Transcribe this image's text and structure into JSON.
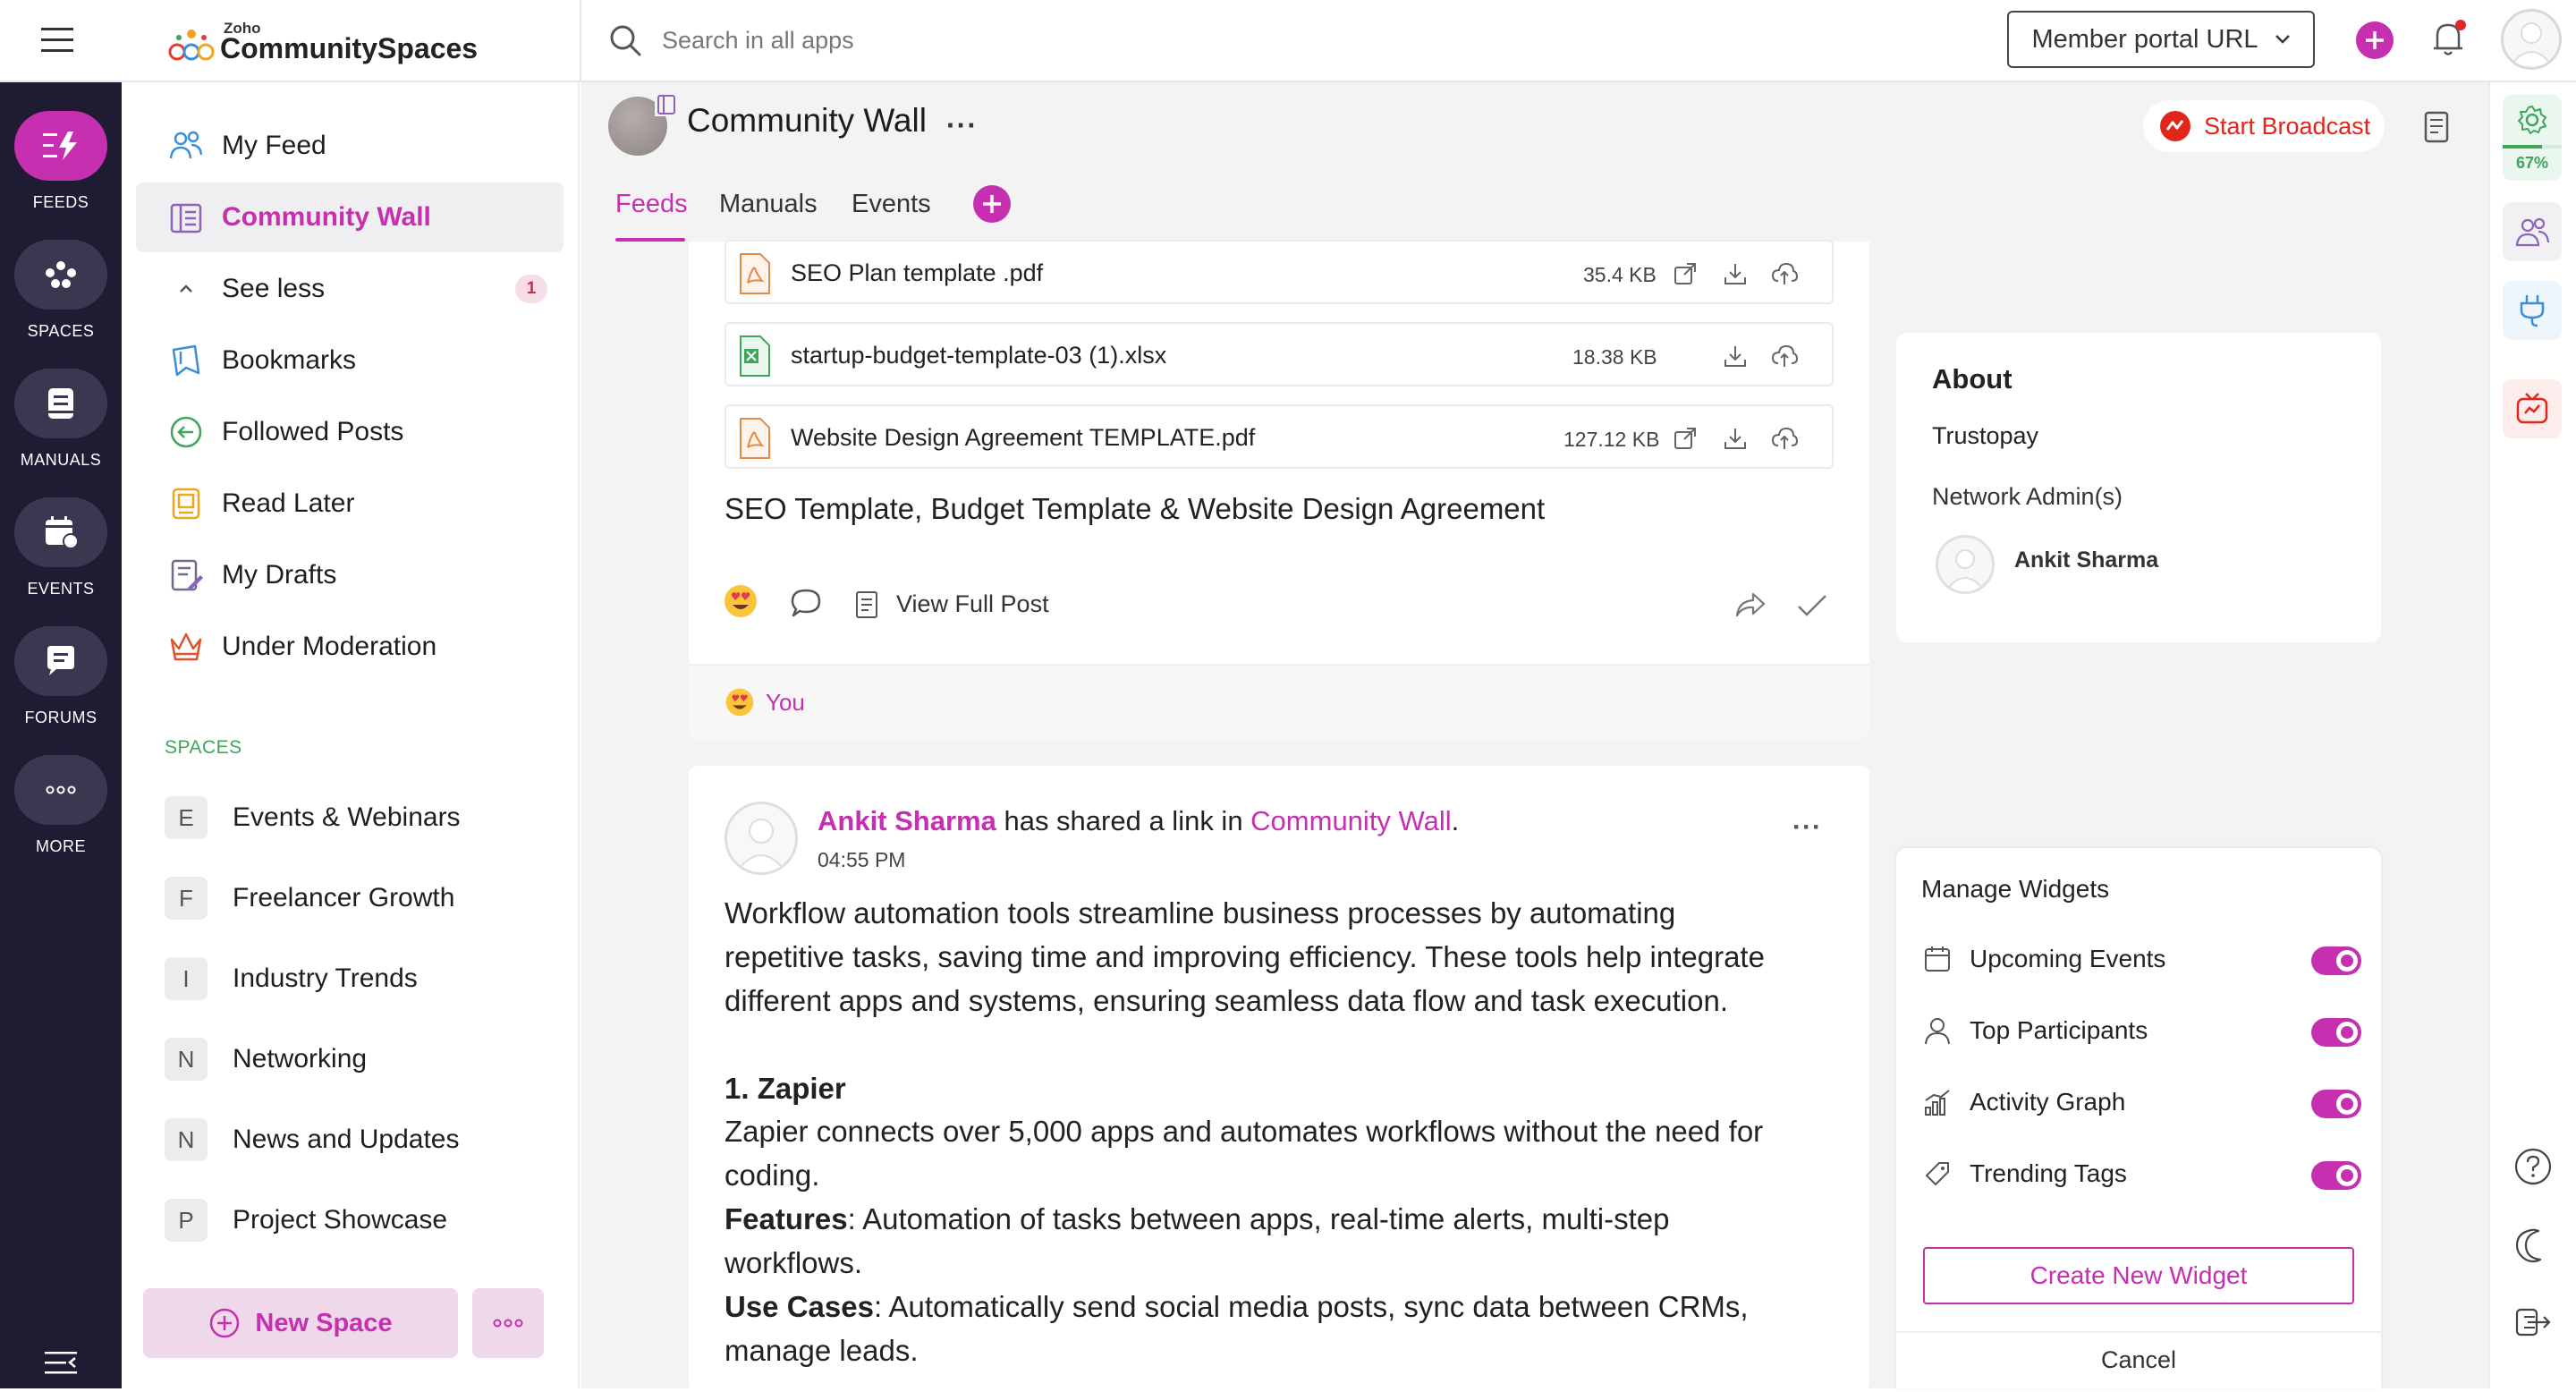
{
  "header": {
    "logo_small": "Zoho",
    "logo_big": "CommunitySpaces",
    "search_placeholder": "Search in all apps",
    "portal_button": "Member portal URL"
  },
  "rail": {
    "items": [
      {
        "label": "FEEDS",
        "icon": "feeds-icon",
        "active": true
      },
      {
        "label": "SPACES",
        "icon": "spaces-icon"
      },
      {
        "label": "MANUALS",
        "icon": "manuals-icon"
      },
      {
        "label": "EVENTS",
        "icon": "events-icon"
      },
      {
        "label": "FORUMS",
        "icon": "forums-icon"
      },
      {
        "label": "MORE",
        "icon": "more-icon"
      }
    ]
  },
  "nav": {
    "items": [
      {
        "label": "My Feed",
        "icon": "users-icon"
      },
      {
        "label": "Community Wall",
        "icon": "wall-icon",
        "active": true
      },
      {
        "label": "See less",
        "icon": "chevron-up-icon",
        "badge": "1"
      },
      {
        "label": "Bookmarks",
        "icon": "bookmark-icon"
      },
      {
        "label": "Followed Posts",
        "icon": "follow-icon"
      },
      {
        "label": "Read Later",
        "icon": "read-later-icon"
      },
      {
        "label": "My Drafts",
        "icon": "drafts-icon"
      },
      {
        "label": "Under Moderation",
        "icon": "crown-icon"
      }
    ],
    "spaces_title": "SPACES",
    "spaces": [
      {
        "letter": "E",
        "label": "Events & Webinars"
      },
      {
        "letter": "F",
        "label": "Freelancer Growth"
      },
      {
        "letter": "I",
        "label": "Industry Trends"
      },
      {
        "letter": "N",
        "label": "Networking"
      },
      {
        "letter": "N",
        "label": "News and Updates"
      },
      {
        "letter": "P",
        "label": "Project Showcase"
      }
    ],
    "new_space": "New Space"
  },
  "main": {
    "title": "Community Wall",
    "broadcast": "Start Broadcast",
    "tabs": [
      "Feeds",
      "Manuals",
      "Events"
    ],
    "attachments": [
      {
        "name": "SEO Plan template .pdf",
        "size": "35.4 KB",
        "type": "pdf"
      },
      {
        "name": "startup-budget-template-03 (1).xlsx",
        "size": "18.38 KB",
        "type": "xlsx"
      },
      {
        "name": "Website Design Agreement TEMPLATE.pdf",
        "size": "127.12 KB",
        "type": "pdf"
      }
    ],
    "post1_text": "SEO Template, Budget Template & Website Design Agreement",
    "view_full_post": "View Full Post",
    "reaction_you": "You",
    "post2": {
      "author": "Ankit Sharma",
      "action": " has shared a link in ",
      "space": "Community Wall",
      "period": ".",
      "time": "04:55 PM",
      "para1_l1": "Workflow automation tools streamline business processes by automating",
      "para1_l2": "repetitive tasks, saving time and improving efficiency. These tools help integrate",
      "para1_l3": "different apps and systems, ensuring seamless data flow and task execution.",
      "heading": "1. Zapier",
      "line_a": "Zapier connects over 5,000 apps and automates workflows without the need for",
      "line_b": "coding.",
      "features_label": "Features",
      "features_l1": ": Automation of tasks between apps, real-time alerts, multi-step",
      "features_l2": "workflows.",
      "usecases_label": "Use Cases",
      "usecases_l1": ": Automatically send social media posts, sync data between CRMs,",
      "usecases_l2": "manage leads."
    }
  },
  "about": {
    "title": "About",
    "org": "Trustopay",
    "admins_label": "Network Admin(s)",
    "admin_name": "Ankit Sharma"
  },
  "widgets": {
    "title": "Manage Widgets",
    "items": [
      {
        "label": "Upcoming Events",
        "icon": "calendar-icon",
        "on": true
      },
      {
        "label": "Top Participants",
        "icon": "user-icon",
        "on": true
      },
      {
        "label": "Activity Graph",
        "icon": "graph-icon",
        "on": true
      },
      {
        "label": "Trending Tags",
        "icon": "tag-icon",
        "on": true
      }
    ],
    "create": "Create New Widget",
    "cancel": "Cancel"
  },
  "right_rail": {
    "progress_text": "67%",
    "progress": 0.67
  },
  "colors": {
    "accent": "#c72fb1",
    "rail": "#1f1b32",
    "broadcast": "#e1251b"
  }
}
